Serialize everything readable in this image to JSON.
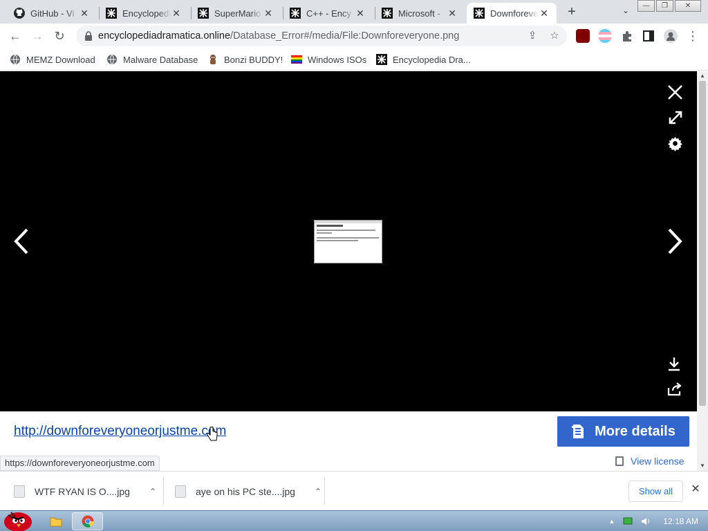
{
  "tabs": [
    {
      "title": "GitHub - Vi",
      "icon": "github-icon",
      "active": false
    },
    {
      "title": "Encyclopedi",
      "icon": "ed-icon",
      "active": false
    },
    {
      "title": "SuperMario",
      "icon": "ed-icon",
      "active": false
    },
    {
      "title": "C++ - Ency",
      "icon": "ed-icon",
      "active": false
    },
    {
      "title": "Microsoft -",
      "icon": "ed-icon",
      "active": false
    },
    {
      "title": "Downforeve",
      "icon": "ed-icon",
      "active": true
    }
  ],
  "tab_close_glyph": "✕",
  "new_tab_glyph": "+",
  "tab_search_glyph": "⌄",
  "window_controls": {
    "minimize": "—",
    "maximize": "❐",
    "close": "✕"
  },
  "toolbar": {
    "back": "←",
    "forward": "→",
    "reload": "↻",
    "url_host": "encyclopediadramatica.online",
    "url_path": "/Database_Error#/media/File:Downforeveryone.png",
    "share_glyph": "⇪",
    "star_glyph": "☆",
    "menu_glyph": "⋮"
  },
  "bookmarks": [
    {
      "label": "MEMZ Download",
      "icon": "globe-icon"
    },
    {
      "label": "Malware Database",
      "icon": "globe-icon"
    },
    {
      "label": "Bonzi BUDDY!",
      "icon": "bonzi-icon"
    },
    {
      "label": "Windows ISOs",
      "icon": "rainbow-flag-icon"
    },
    {
      "label": "Encyclopedia Dra...",
      "icon": "ed-icon"
    }
  ],
  "viewer": {
    "close_glyph": "✕",
    "prev_glyph": "‹",
    "next_glyph": "›",
    "file_link": "http://downforeveryoneorjustme.com",
    "more_details": "More details",
    "view_license": "View license",
    "thumbnail_title": "Lorem Ipsum Dolor",
    "thumbnail_line1": "Lorem ipsum dolor sit amet consectetur adipiscing elit sed do eiusmod",
    "thumbnail_line2": "Ut enim ad minim veniam quis nostrud exercitation ullamco laboris nisi"
  },
  "status_url": "https://downforeveryoneorjustme.com",
  "downloads": [
    {
      "name": "WTF RYAN IS O....jpg"
    },
    {
      "name": "aye on his PC ste....jpg"
    }
  ],
  "downloads_chevron": "⌃",
  "show_all": "Show all",
  "shelf_close_glyph": "✕",
  "taskbar": {
    "clock": "12:18 AM",
    "tray_up": "▲"
  },
  "colors": {
    "accent": "#3366cc",
    "link": "#0645ad",
    "viewer_bg": "#000000"
  }
}
